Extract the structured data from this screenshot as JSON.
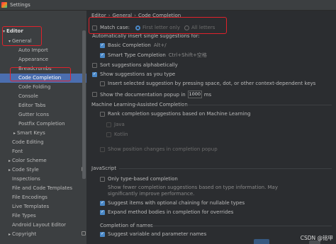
{
  "window": {
    "title": "Settings"
  },
  "sidebar": {
    "items": [
      {
        "label": "Editor",
        "arrow": "▾",
        "level": 0,
        "bold": true
      },
      {
        "label": "General",
        "arrow": "▾",
        "level": 1
      },
      {
        "label": "Auto Import",
        "level": 2,
        "gear": false
      },
      {
        "label": "Appearance",
        "level": 2
      },
      {
        "label": "Breadcrumbs",
        "level": 2
      },
      {
        "label": "Code Completion",
        "level": 2,
        "selected": true
      },
      {
        "label": "Code Folding",
        "level": 2
      },
      {
        "label": "Console",
        "level": 2
      },
      {
        "label": "Editor Tabs",
        "level": 2
      },
      {
        "label": "Gutter Icons",
        "level": 2
      },
      {
        "label": "Postfix Completion",
        "level": 2
      },
      {
        "label": "Smart Keys",
        "arrow": "▸",
        "level": 1
      },
      {
        "label": "Code Editing",
        "level": 1
      },
      {
        "label": "Font",
        "level": 1
      },
      {
        "label": "Color Scheme",
        "arrow": "▸",
        "level": 1
      },
      {
        "label": "Code Style",
        "arrow": "▸",
        "level": 1,
        "gear": true
      },
      {
        "label": "Inspections",
        "level": 1,
        "gear": true
      },
      {
        "label": "File and Code Templates",
        "level": 1,
        "gear": true
      },
      {
        "label": "File Encodings",
        "level": 1,
        "gear": true
      },
      {
        "label": "Live Templates",
        "level": 1
      },
      {
        "label": "File Types",
        "level": 1
      },
      {
        "label": "Android Layout Editor",
        "level": 1
      },
      {
        "label": "Copyright",
        "arrow": "▸",
        "level": 1,
        "gear": true
      }
    ]
  },
  "breadcrumb": [
    "Editor",
    "General",
    "Code Completion"
  ],
  "completion": {
    "match_case_label": "Match case:",
    "match_case_checked": false,
    "radio_first": "First letter only",
    "radio_all": "All letters",
    "auto_insert_label": "Automatically insert single suggestions for:",
    "basic_label": "Basic Completion",
    "basic_shortcut": "Alt+/",
    "smart_label": "Smart Type Completion",
    "smart_shortcut": "Ctrl+Shift+空格",
    "sort_label": "Sort suggestions alphabetically",
    "show_as_type_label": "Show suggestions as you type",
    "insert_selected_label": "Insert selected suggestion by pressing space, dot, or other context-dependent keys",
    "doc_popup_label": "Show the documentation popup in",
    "doc_popup_value": "1000",
    "doc_popup_unit": "ms"
  },
  "ml": {
    "section": "Machine Learning-Assisted Completion",
    "rank_label": "Rank completion suggestions based on Machine Learning",
    "java": "Java",
    "kotlin": "Kotlin",
    "show_pos_label": "Show position changes in completion popup"
  },
  "javascript": {
    "section": "JavaScript",
    "type_based_label": "Only type-based completion",
    "type_based_hint_1": "Show fewer completion suggestions based on type information. May",
    "type_based_hint_2": "significantly improve performance.",
    "optional_chain_label": "Suggest items with optional chaining for nullable types",
    "expand_method_label": "Expand method bodies in completion for overrides"
  },
  "names": {
    "section": "Completion of names",
    "suggest_vars_label": "Suggest variable and parameter names"
  },
  "footer": {
    "watermark": "CSDN @铭甲"
  },
  "colors": {
    "accent": "#4a88c7",
    "highlight_box": "#e0222b",
    "selection": "#4b6eaf"
  }
}
